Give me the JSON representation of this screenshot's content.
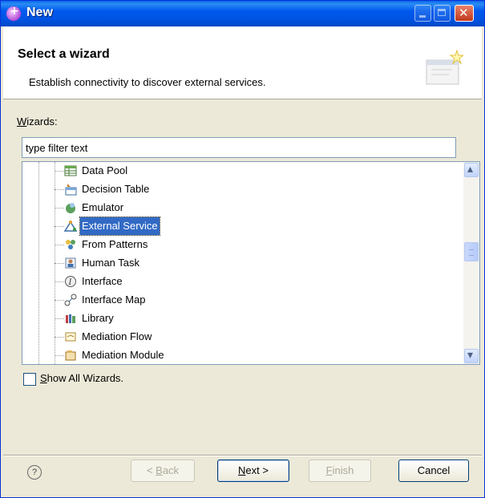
{
  "window": {
    "title": "New"
  },
  "banner": {
    "title": "Select a wizard",
    "description": "Establish connectivity to discover external services."
  },
  "wizards": {
    "label_pre": "",
    "label_mnemonic": "W",
    "label_post": "izards:",
    "filter_value": "type filter text",
    "items": [
      {
        "label": "Data Pool",
        "icon": "table-icon"
      },
      {
        "label": "Decision Table",
        "icon": "decision-table-icon"
      },
      {
        "label": "Emulator",
        "icon": "emulator-icon"
      },
      {
        "label": "External Service",
        "icon": "external-service-icon",
        "selected": true
      },
      {
        "label": "From Patterns",
        "icon": "patterns-icon"
      },
      {
        "label": "Human Task",
        "icon": "human-task-icon"
      },
      {
        "label": "Interface",
        "icon": "interface-icon"
      },
      {
        "label": "Interface Map",
        "icon": "interface-map-icon"
      },
      {
        "label": "Library",
        "icon": "library-icon"
      },
      {
        "label": "Mediation Flow",
        "icon": "mediation-flow-icon"
      },
      {
        "label": "Mediation Module",
        "icon": "mediation-module-icon"
      }
    ]
  },
  "show_all": {
    "mnemonic": "S",
    "rest": "how All Wizards.",
    "checked": false
  },
  "buttons": {
    "help": "?",
    "back_pre": "< ",
    "back_mn": "B",
    "back_post": "ack",
    "next_mn": "N",
    "next_post": "ext >",
    "finish_mn": "F",
    "finish_post": "inish",
    "cancel": "Cancel"
  },
  "colors": {
    "title_bar": "#0054e3",
    "selection": "#316ac5",
    "dialog_bg": "#ece9d8"
  }
}
